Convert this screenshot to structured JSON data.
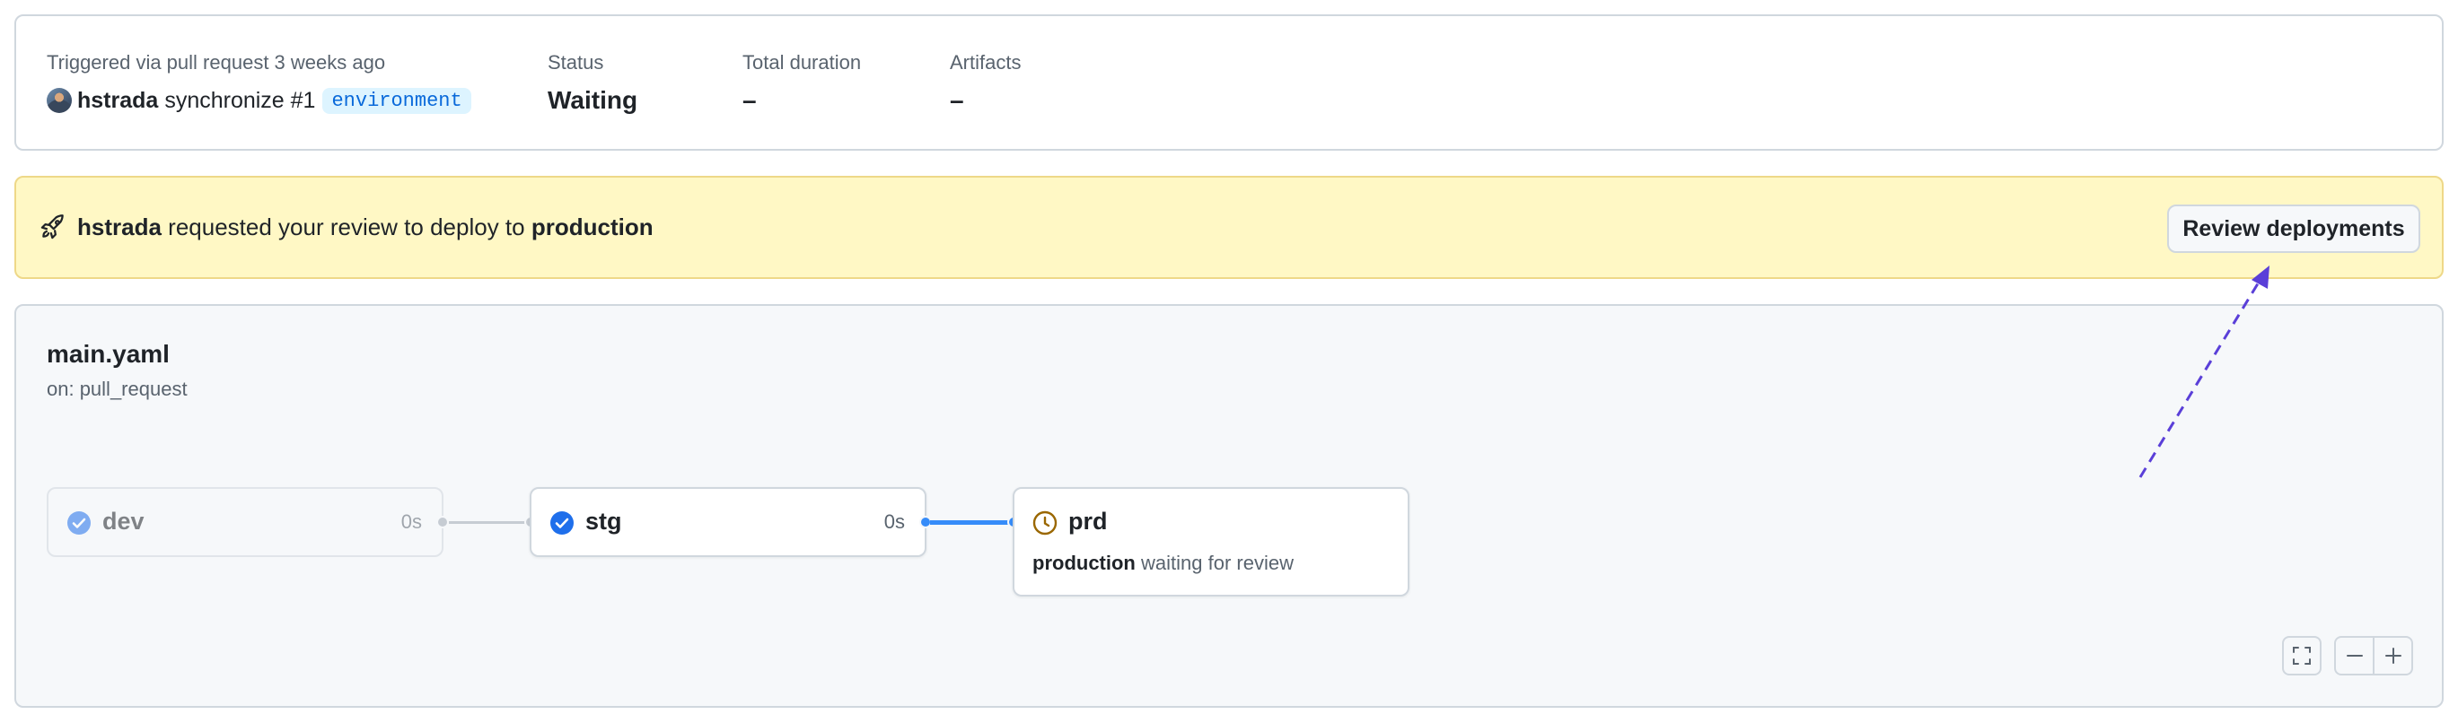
{
  "summary": {
    "trigger_label": "Triggered via pull request 3 weeks ago",
    "actor": "hstrada",
    "event": "synchronize #1",
    "environment_badge": "environment",
    "status_label": "Status",
    "status_value": "Waiting",
    "duration_label": "Total duration",
    "duration_value": "–",
    "artifacts_label": "Artifacts",
    "artifacts_value": "–"
  },
  "banner": {
    "actor": "hstrada",
    "text": "requested your review to deploy to",
    "environment": "production",
    "button_label": "Review deployments",
    "icon": "rocket-icon"
  },
  "workflow": {
    "file": "main.yaml",
    "trigger": "on: pull_request",
    "jobs": [
      {
        "name": "dev",
        "duration": "0s",
        "status": "success",
        "icon": "check-circle-icon"
      },
      {
        "name": "stg",
        "duration": "0s",
        "status": "success",
        "icon": "check-circle-icon"
      },
      {
        "name": "prd",
        "status": "waiting",
        "icon": "clock-icon",
        "environment": "production",
        "note": "waiting for review"
      }
    ],
    "controls": [
      "fullscreen-icon",
      "zoom-out-icon",
      "zoom-in-icon"
    ]
  },
  "colors": {
    "accent_blue": "#368cf9",
    "success_blue": "#1f6feb",
    "banner_bg": "#fff8c5",
    "banner_border": "#eed888",
    "waiting": "#9a6700",
    "annotation_arrow": "#5a3fd8"
  }
}
